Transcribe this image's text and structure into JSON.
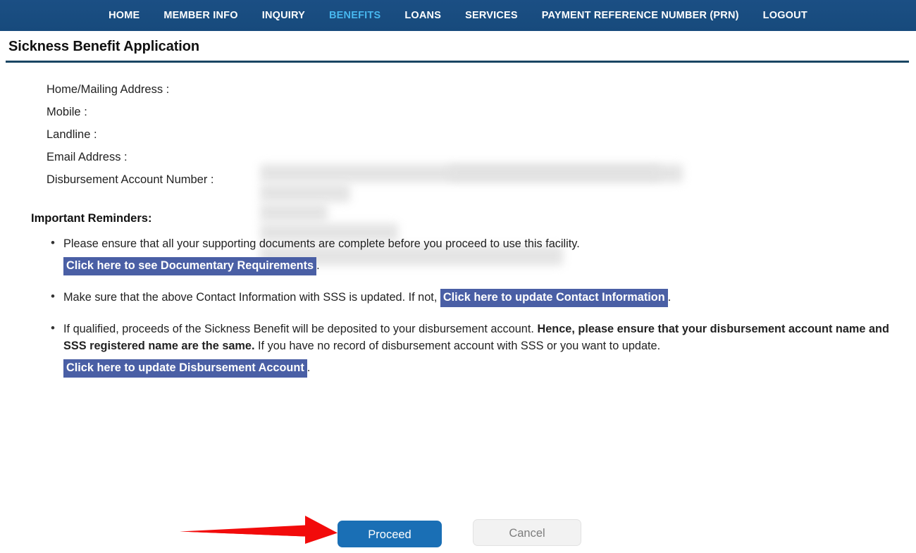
{
  "nav": {
    "items": [
      {
        "label": "HOME",
        "active": false
      },
      {
        "label": "MEMBER INFO",
        "active": false
      },
      {
        "label": "INQUIRY",
        "active": false
      },
      {
        "label": "BENEFITS",
        "active": true
      },
      {
        "label": "LOANS",
        "active": false
      },
      {
        "label": "SERVICES",
        "active": false
      },
      {
        "label": "PAYMENT REFERENCE NUMBER (PRN)",
        "active": false
      },
      {
        "label": "LOGOUT",
        "active": false
      }
    ],
    "active_color": "#47b7ef",
    "bar_color": "#1a4d80"
  },
  "page": {
    "title": "Sickness Benefit Application",
    "rule_color": "#1a4663"
  },
  "contact_info": {
    "rows": [
      {
        "label": "Home/Mailing Address :",
        "value": ""
      },
      {
        "label": "Mobile :",
        "value": ""
      },
      {
        "label": "Landline :",
        "value": ""
      },
      {
        "label": "Email Address :",
        "value": ""
      },
      {
        "label": "Disbursement Account Number :",
        "value": ""
      }
    ],
    "values_redacted": true
  },
  "reminders": {
    "heading": "Important Reminders:",
    "items": [
      {
        "text_before": "Please ensure that all your supporting documents are complete before you proceed to use this facility.",
        "link_label": "Click here to see Documentary Requirements",
        "text_after": ".",
        "link_on_new_line": true
      },
      {
        "text_before": "Make sure that the above Contact Information with SSS is updated. If not,",
        "link_label": "Click here to update Contact Information",
        "text_after": ".",
        "link_on_new_line": false
      },
      {
        "text_before": "If qualified, proceeds of the Sickness Benefit will be deposited to your disbursement account.",
        "text_bold": "Hence, please ensure that your disbursement account name and SSS registered name are the same.",
        "text_middle": "If you have no record of disbursement account with SSS or you want to update.",
        "link_label": "Click here to update Disbursement Account",
        "text_after": ".",
        "link_on_new_line": true
      }
    ],
    "link_bg_color": "#4a5fa5",
    "link_text_color": "#ffffff"
  },
  "buttons": {
    "proceed": {
      "label": "Proceed",
      "bg": "#1a6fb5",
      "fg": "#ffffff"
    },
    "cancel": {
      "label": "Cancel",
      "bg": "#f2f2f2",
      "fg": "#7d7d7d"
    }
  },
  "annotation": {
    "arrow": {
      "color": "#f20b0b",
      "direction": "right",
      "points_to": "Proceed"
    }
  }
}
